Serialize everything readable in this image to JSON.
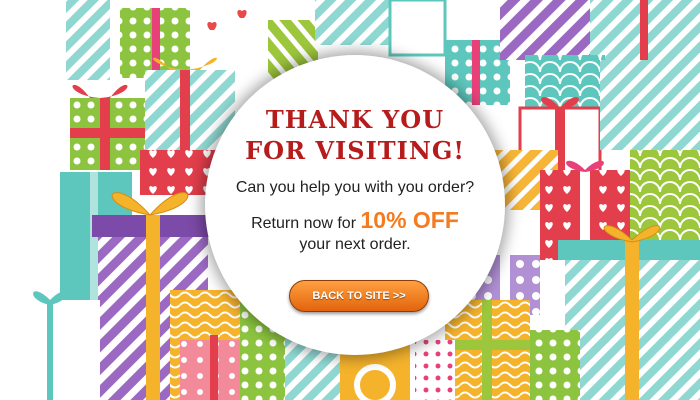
{
  "popup": {
    "title_line1": "THANK YOU",
    "title_line2": "FOR VISITING!",
    "message_line1": "Can you help you with you order?",
    "message_line2_prefix": "Return now for ",
    "offer": "10% OFF",
    "message_line3": "your next order.",
    "button_label": "BACK TO SITE  >>"
  },
  "colors": {
    "title": "#b71c1c",
    "offer": "#f47b20",
    "button_top": "#ffa040",
    "button_bottom": "#e2640c",
    "background_palette": [
      "#5ec7bd",
      "#9cc63b",
      "#f5b32c",
      "#e8417a",
      "#8e5bb3",
      "#f28a8a",
      "#cf2d3a"
    ]
  },
  "background": {
    "theme": "gift-boxes-pattern"
  }
}
